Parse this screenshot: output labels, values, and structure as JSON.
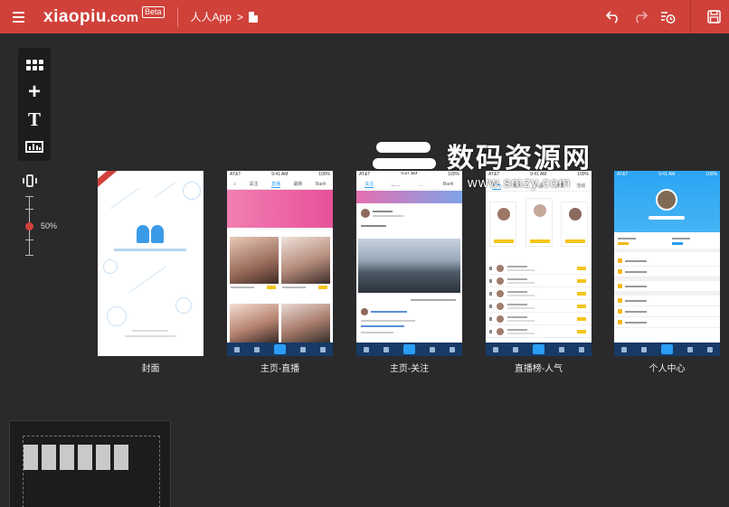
{
  "app": {
    "logo_text": "xiaopiu",
    "logo_suffix": ".com",
    "beta_badge": "Beta",
    "breadcrumb_project": "人人App",
    "breadcrumb_sep": ">"
  },
  "toolbar_right": {
    "icons": [
      "undo-icon",
      "redo-icon",
      "history-icon",
      "save-icon"
    ]
  },
  "left_tools": {
    "icons": [
      "components-grid-icon",
      "add-icon",
      "text-icon",
      "widget-icon"
    ]
  },
  "zoom": {
    "label": "50%",
    "value": 0.5
  },
  "watermark": {
    "text": "数码资源网",
    "url": "www.smzy.com"
  },
  "screens": [
    {
      "label": "封面"
    },
    {
      "label": "主页-直播"
    },
    {
      "label": "主页-关注"
    },
    {
      "label": "直播榜-人气"
    },
    {
      "label": "个人中心"
    }
  ],
  "mock": {
    "status_carrier": "AT&T",
    "status_time": "9:41 AM",
    "status_battery": "100%",
    "live_tabs": [
      "关注",
      "直播",
      "最新",
      "Banh"
    ],
    "follow_tabs": [
      "关注",
      "直播",
      "最新",
      "Banh"
    ],
    "rank_tabs": [
      "人气",
      "收入",
      "人品",
      "分享",
      "活动"
    ]
  },
  "colors": {
    "topbar": "#d0413a",
    "canvas": "#2a2a2c",
    "accent_blue": "#2a9df4",
    "tabbar": "#173a66",
    "rank_yellow": "#f5c518"
  }
}
